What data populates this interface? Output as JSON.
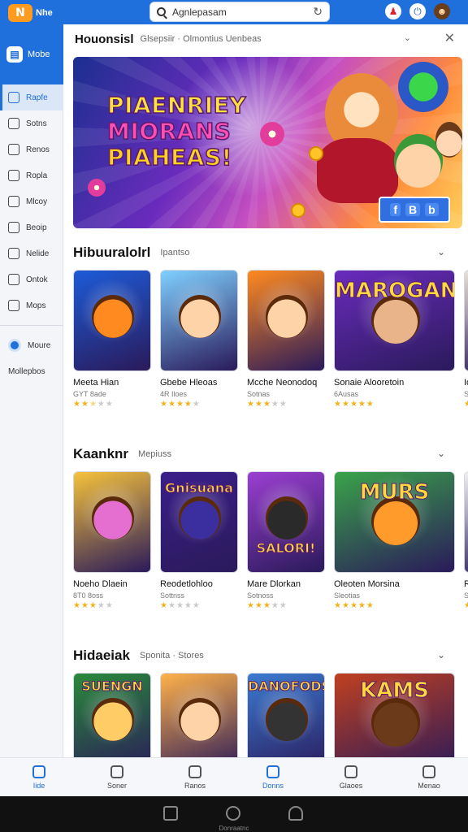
{
  "app": {
    "logo_mark": "N",
    "logo_text": "Nhe"
  },
  "search": {
    "placeholder": "Agnlepasam",
    "value": "Agnlepasam"
  },
  "sidebar": {
    "home_label": "Mobe",
    "items": [
      {
        "label": "Rapfe",
        "icon": "bookmark-icon",
        "active": true
      },
      {
        "label": "Sotns",
        "icon": "bag-icon",
        "active": false
      },
      {
        "label": "Renos",
        "icon": "cart-icon",
        "active": false
      },
      {
        "label": "Ropla",
        "icon": "people-icon",
        "active": false
      },
      {
        "label": "Mlcoy",
        "icon": "chart-icon",
        "active": false
      },
      {
        "label": "Beoip",
        "icon": "shield-icon",
        "active": false
      },
      {
        "label": "Nelide",
        "icon": "phone-icon",
        "active": false
      },
      {
        "label": "Ontok",
        "icon": "calendar-icon",
        "active": false
      },
      {
        "label": "Mops",
        "icon": "nav-icon",
        "active": false
      }
    ],
    "extra_label": "Moure",
    "extra_label_2": "Mollepbos"
  },
  "main": {
    "header_title": "Houonsisl",
    "header_sub": "Glsepsiir  ·  Olmontius Uenbeas",
    "banner": {
      "line1": "PIAENRIEY",
      "line2": "MIORANS",
      "line3": "PIAHEAS!",
      "badge": [
        "f",
        "B",
        "b"
      ]
    },
    "sections": [
      {
        "title": "Hibuuralolrl",
        "sub": "Ipantso",
        "cards": [
          {
            "name": "Meeta Hian",
            "meta": "GYT 8ade",
            "rating": 2.5,
            "thumb_text": ""
          },
          {
            "name": "Gbebe Hleoas",
            "meta": "4R Iloes",
            "rating": 4,
            "thumb_text": ""
          },
          {
            "name": "Mcche Neonodoq",
            "meta": "Sotnas",
            "rating": 3,
            "thumb_text": ""
          },
          {
            "name": "Sonaie Alooretoin",
            "meta": "6Ausas",
            "rating": 5,
            "thumb_text": "MAROGAN"
          },
          {
            "name": "Iolacniun",
            "meta": "Seotie",
            "rating": 4,
            "thumb_text": ""
          }
        ]
      },
      {
        "title": "Kaanknr",
        "sub": "Mepiuss",
        "cards": [
          {
            "name": "Noeho Dlaein",
            "meta": "8T0 8oss",
            "rating": 3,
            "thumb_text": ""
          },
          {
            "name": "Reodetlohloo",
            "meta": "Sottnss",
            "rating": 1,
            "thumb_text": "Gnisuana"
          },
          {
            "name": "Mare Dlorkan",
            "meta": "Sotnoss",
            "rating": 3,
            "thumb_text": "SALORI!"
          },
          {
            "name": "Oleoten Morsina",
            "meta": "Sleotias",
            "rating": 5,
            "thumb_text": "MURS"
          },
          {
            "name": "Roochen",
            "meta": "Seeals",
            "rating": 5,
            "thumb_text": ""
          }
        ]
      },
      {
        "title": "Hidaeiak",
        "sub": "Sponita  ·  Stores",
        "cards": [
          {
            "name": "",
            "meta": "",
            "rating": 0,
            "thumb_text": "SUENGN"
          },
          {
            "name": "",
            "meta": "",
            "rating": 0,
            "thumb_text": ""
          },
          {
            "name": "",
            "meta": "",
            "rating": 0,
            "thumb_text": "DANOFODS"
          },
          {
            "name": "",
            "meta": "",
            "rating": 0,
            "thumb_text": "KAMS"
          }
        ]
      }
    ]
  },
  "bottom_nav": [
    {
      "label": "Iide",
      "active": true
    },
    {
      "label": "Soner",
      "active": false
    },
    {
      "label": "Ranos",
      "active": false
    },
    {
      "label": "Donns",
      "active": true
    },
    {
      "label": "Glaoes",
      "active": false
    },
    {
      "label": "Menao",
      "active": false
    }
  ],
  "system": {
    "label": "Donraatnc"
  },
  "colors": {
    "accent": "#1f6fdc",
    "star": "#f2b21b"
  }
}
